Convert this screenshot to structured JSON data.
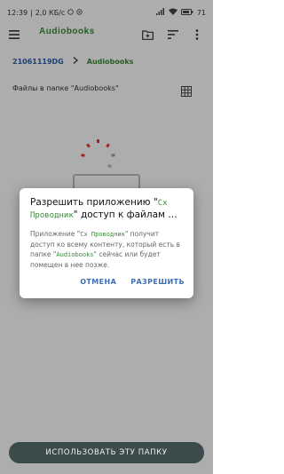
{
  "status_bar": {
    "time": "12:39",
    "net_speed": "2,0 КБ/с",
    "battery": "71"
  },
  "toolbar": {
    "title": "Audiobooks",
    "menu_icon": "hamburger-menu-icon",
    "new_folder_icon": "create-new-folder-icon",
    "sort_icon": "sort-icon",
    "more_icon": "more-vert-icon"
  },
  "breadcrumb": {
    "root": "21061119DG",
    "separator_icon": "chevron-right-icon",
    "current": "Audiobooks"
  },
  "files": {
    "header": "Файлы в папке \"Audiobooks\"",
    "view_icon": "grid-view-icon"
  },
  "dialog": {
    "title_prefix": "Разрешить приложению \"",
    "title_app": "Cx Проводник",
    "title_suffix": "\" доступ к файлам …",
    "body_prefix": "Приложение \"",
    "body_app": "Cx Проводник",
    "body_middle": "\" получит доступ ко всему контенту, который есть в папке \"",
    "body_folder": "Audiobooks",
    "body_suffix": "\" сейчас или будет помещен в нее позже.",
    "cancel_label": "ОТМЕНА",
    "allow_label": "РАЗРЕШИТЬ"
  },
  "bottom_button": {
    "label": "ИСПОЛЬЗОВАТЬ ЭТУ ПАПКУ"
  },
  "colors": {
    "accent_green": "#3a8a3a",
    "link_blue": "#3f6fb6",
    "button_dark": "#3b4a4a"
  }
}
